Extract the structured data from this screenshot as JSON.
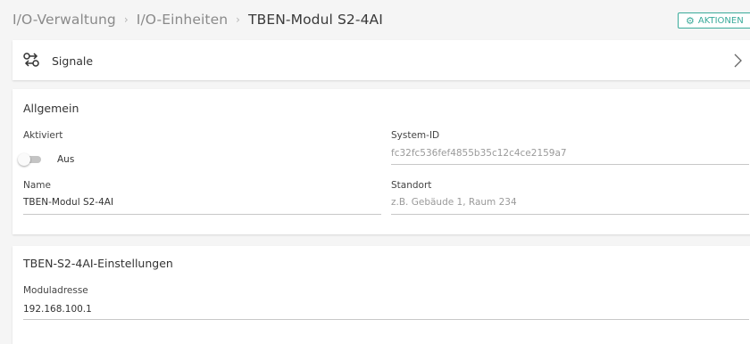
{
  "breadcrumb": {
    "items": [
      "I/O-Verwaltung",
      "I/O-Einheiten"
    ],
    "current": "TBEN-Modul S2-4AI",
    "separator": "›"
  },
  "header": {
    "actions_label": "AKTIONEN",
    "actions_icon": "gear-icon",
    "accent_color": "#3aaa9a"
  },
  "signale": {
    "label": "Signale",
    "icon": "signals-icon",
    "chevron_icon": "chevron-right-icon"
  },
  "allgemein": {
    "title": "Allgemein",
    "aktiviert": {
      "label": "Aktiviert",
      "state_text": "Aus",
      "enabled": false
    },
    "system_id": {
      "label": "System-ID",
      "value": "fc32fc536fef4855b35c12c4ce2159a7"
    },
    "name": {
      "label": "Name",
      "value": "TBEN-Modul S2-4AI"
    },
    "standort": {
      "label": "Standort",
      "value": "",
      "placeholder": "z.B. Gebäude 1, Raum 234"
    }
  },
  "einstellungen": {
    "title": "TBEN-S2-4AI-Einstellungen",
    "moduladresse": {
      "label": "Moduladresse",
      "value": "192.168.100.1"
    }
  }
}
